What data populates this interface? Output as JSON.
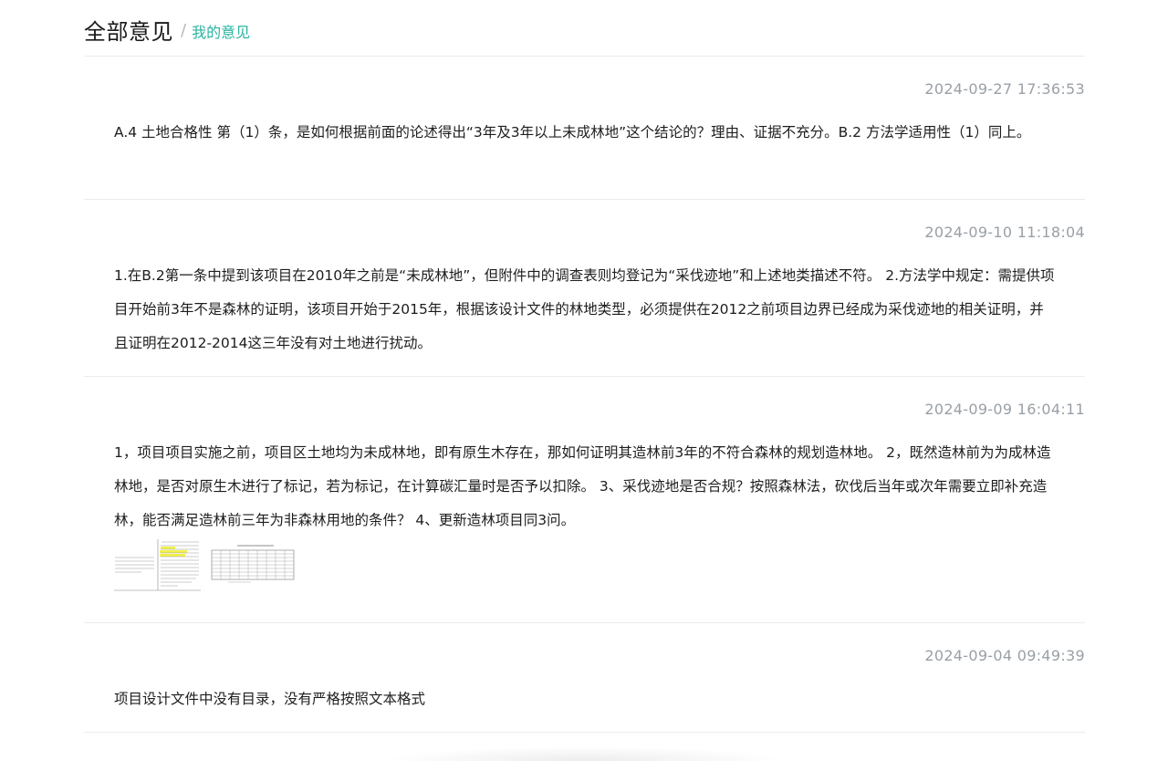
{
  "header": {
    "title": "全部意见",
    "separator": "/",
    "sub_link": "我的意见"
  },
  "colors": {
    "accent": "#2bb3a0",
    "timestamp": "#9aa0a6",
    "divider": "#ececec",
    "highlight": "#f3f24a"
  },
  "feedback": [
    {
      "timestamp": "2024-09-27 17:36:53",
      "text": "A.4 土地合格性 第（1）条，是如何根据前面的论述得出“3年及3年以上未成林地”这个结论的？理由、证据不充分。B.2 方法学适用性（1）同上。"
    },
    {
      "timestamp": "2024-09-10 11:18:04",
      "text": "1.在B.2第一条中提到该项目在2010年之前是“未成林地”，但附件中的调查表则均登记为“采伐迹地”和上述地类描述不符。 2.方法学中规定：需提供项目开始前3年不是森林的证明，该项目开始于2015年，根据该设计文件的林地类型，必须提供在2012之前项目边界已经成为采伐迹地的相关证明，并且证明在2012-2014这三年没有对土地进行扰动。"
    },
    {
      "timestamp": "2024-09-09 16:04:11",
      "text": "1，项目项目实施之前，项目区土地均为未成林地，即有原生木存在，那如何证明其造林前3年的不符合森林的规划造林地。 2，既然造林前为为成林造林地，是否对原生木进行了标记，若为标记，在计算碳汇量时是否予以扣除。 3、采伐迹地是否合规？按照森林法，砍伐后当年或次年需要立即补充造林，能否满足造林前三年为非森林用地的条件？ 4、更新造林项目同3问。",
      "attachments": [
        "document-thumbnail",
        "table-thumbnail"
      ]
    },
    {
      "timestamp": "2024-09-04 09:49:39",
      "text": "项目设计文件中没有目录，没有严格按照文本格式"
    }
  ]
}
